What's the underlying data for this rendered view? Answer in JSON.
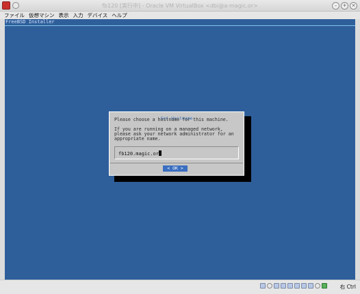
{
  "window": {
    "title": "fb120 [実行中] - Oracle VM VirtualBox <dbi@a-magic.or>",
    "icons": [
      "app-icon",
      "pin-icon"
    ],
    "controls": [
      "minimize-icon",
      "maximize-icon",
      "close-icon"
    ]
  },
  "menu": {
    "items": [
      "ファイル",
      "仮想マシン",
      "表示",
      "入力",
      "デバイス",
      "ヘルプ"
    ]
  },
  "installer": {
    "header": "FreeBSD Installer",
    "dialog": {
      "title": "Set Hostname",
      "lines": [
        "Please choose a hostname for this machine.",
        "",
        "If you are running on a managed network,",
        "please ask your network administrator for an",
        "appropriate name."
      ],
      "input_value": "fb120.magic.or",
      "ok_label": "<  OK  >"
    }
  },
  "statusbar": {
    "icons": [
      "hdd-icon",
      "optical-icon",
      "usb-icon",
      "network-icon",
      "shared-folder-icon",
      "display-icon",
      "video-capture-icon",
      "recording-icon",
      "cpu-icon",
      "mouse-integration-icon"
    ],
    "host_key": "右 Ctrl"
  },
  "colors": {
    "screen_bg": "#2f5f9b",
    "dialog_bg": "#c7c7c7",
    "title_accent": "#3f78c0",
    "ok_button": "#3a6ec0"
  }
}
